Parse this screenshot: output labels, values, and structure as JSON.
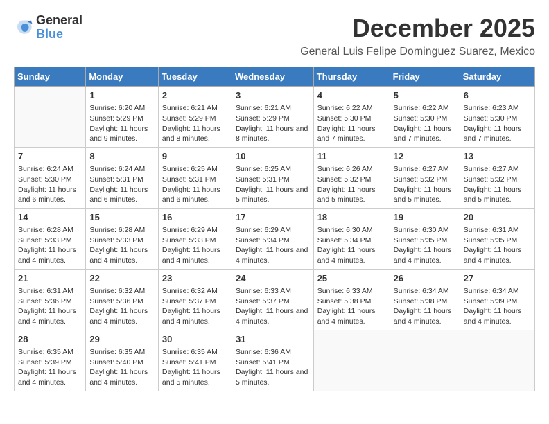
{
  "header": {
    "logo_general": "General",
    "logo_blue": "Blue",
    "month": "December 2025",
    "location": "General Luis Felipe Dominguez Suarez, Mexico"
  },
  "days_of_week": [
    "Sunday",
    "Monday",
    "Tuesday",
    "Wednesday",
    "Thursday",
    "Friday",
    "Saturday"
  ],
  "weeks": [
    [
      {
        "day": "",
        "sunrise": "",
        "sunset": "",
        "daylight": ""
      },
      {
        "day": "1",
        "sunrise": "Sunrise: 6:20 AM",
        "sunset": "Sunset: 5:29 PM",
        "daylight": "Daylight: 11 hours and 9 minutes."
      },
      {
        "day": "2",
        "sunrise": "Sunrise: 6:21 AM",
        "sunset": "Sunset: 5:29 PM",
        "daylight": "Daylight: 11 hours and 8 minutes."
      },
      {
        "day": "3",
        "sunrise": "Sunrise: 6:21 AM",
        "sunset": "Sunset: 5:29 PM",
        "daylight": "Daylight: 11 hours and 8 minutes."
      },
      {
        "day": "4",
        "sunrise": "Sunrise: 6:22 AM",
        "sunset": "Sunset: 5:30 PM",
        "daylight": "Daylight: 11 hours and 7 minutes."
      },
      {
        "day": "5",
        "sunrise": "Sunrise: 6:22 AM",
        "sunset": "Sunset: 5:30 PM",
        "daylight": "Daylight: 11 hours and 7 minutes."
      },
      {
        "day": "6",
        "sunrise": "Sunrise: 6:23 AM",
        "sunset": "Sunset: 5:30 PM",
        "daylight": "Daylight: 11 hours and 7 minutes."
      }
    ],
    [
      {
        "day": "7",
        "sunrise": "Sunrise: 6:24 AM",
        "sunset": "Sunset: 5:30 PM",
        "daylight": "Daylight: 11 hours and 6 minutes."
      },
      {
        "day": "8",
        "sunrise": "Sunrise: 6:24 AM",
        "sunset": "Sunset: 5:31 PM",
        "daylight": "Daylight: 11 hours and 6 minutes."
      },
      {
        "day": "9",
        "sunrise": "Sunrise: 6:25 AM",
        "sunset": "Sunset: 5:31 PM",
        "daylight": "Daylight: 11 hours and 6 minutes."
      },
      {
        "day": "10",
        "sunrise": "Sunrise: 6:25 AM",
        "sunset": "Sunset: 5:31 PM",
        "daylight": "Daylight: 11 hours and 5 minutes."
      },
      {
        "day": "11",
        "sunrise": "Sunrise: 6:26 AM",
        "sunset": "Sunset: 5:32 PM",
        "daylight": "Daylight: 11 hours and 5 minutes."
      },
      {
        "day": "12",
        "sunrise": "Sunrise: 6:27 AM",
        "sunset": "Sunset: 5:32 PM",
        "daylight": "Daylight: 11 hours and 5 minutes."
      },
      {
        "day": "13",
        "sunrise": "Sunrise: 6:27 AM",
        "sunset": "Sunset: 5:32 PM",
        "daylight": "Daylight: 11 hours and 5 minutes."
      }
    ],
    [
      {
        "day": "14",
        "sunrise": "Sunrise: 6:28 AM",
        "sunset": "Sunset: 5:33 PM",
        "daylight": "Daylight: 11 hours and 4 minutes."
      },
      {
        "day": "15",
        "sunrise": "Sunrise: 6:28 AM",
        "sunset": "Sunset: 5:33 PM",
        "daylight": "Daylight: 11 hours and 4 minutes."
      },
      {
        "day": "16",
        "sunrise": "Sunrise: 6:29 AM",
        "sunset": "Sunset: 5:33 PM",
        "daylight": "Daylight: 11 hours and 4 minutes."
      },
      {
        "day": "17",
        "sunrise": "Sunrise: 6:29 AM",
        "sunset": "Sunset: 5:34 PM",
        "daylight": "Daylight: 11 hours and 4 minutes."
      },
      {
        "day": "18",
        "sunrise": "Sunrise: 6:30 AM",
        "sunset": "Sunset: 5:34 PM",
        "daylight": "Daylight: 11 hours and 4 minutes."
      },
      {
        "day": "19",
        "sunrise": "Sunrise: 6:30 AM",
        "sunset": "Sunset: 5:35 PM",
        "daylight": "Daylight: 11 hours and 4 minutes."
      },
      {
        "day": "20",
        "sunrise": "Sunrise: 6:31 AM",
        "sunset": "Sunset: 5:35 PM",
        "daylight": "Daylight: 11 hours and 4 minutes."
      }
    ],
    [
      {
        "day": "21",
        "sunrise": "Sunrise: 6:31 AM",
        "sunset": "Sunset: 5:36 PM",
        "daylight": "Daylight: 11 hours and 4 minutes."
      },
      {
        "day": "22",
        "sunrise": "Sunrise: 6:32 AM",
        "sunset": "Sunset: 5:36 PM",
        "daylight": "Daylight: 11 hours and 4 minutes."
      },
      {
        "day": "23",
        "sunrise": "Sunrise: 6:32 AM",
        "sunset": "Sunset: 5:37 PM",
        "daylight": "Daylight: 11 hours and 4 minutes."
      },
      {
        "day": "24",
        "sunrise": "Sunrise: 6:33 AM",
        "sunset": "Sunset: 5:37 PM",
        "daylight": "Daylight: 11 hours and 4 minutes."
      },
      {
        "day": "25",
        "sunrise": "Sunrise: 6:33 AM",
        "sunset": "Sunset: 5:38 PM",
        "daylight": "Daylight: 11 hours and 4 minutes."
      },
      {
        "day": "26",
        "sunrise": "Sunrise: 6:34 AM",
        "sunset": "Sunset: 5:38 PM",
        "daylight": "Daylight: 11 hours and 4 minutes."
      },
      {
        "day": "27",
        "sunrise": "Sunrise: 6:34 AM",
        "sunset": "Sunset: 5:39 PM",
        "daylight": "Daylight: 11 hours and 4 minutes."
      }
    ],
    [
      {
        "day": "28",
        "sunrise": "Sunrise: 6:35 AM",
        "sunset": "Sunset: 5:39 PM",
        "daylight": "Daylight: 11 hours and 4 minutes."
      },
      {
        "day": "29",
        "sunrise": "Sunrise: 6:35 AM",
        "sunset": "Sunset: 5:40 PM",
        "daylight": "Daylight: 11 hours and 4 minutes."
      },
      {
        "day": "30",
        "sunrise": "Sunrise: 6:35 AM",
        "sunset": "Sunset: 5:41 PM",
        "daylight": "Daylight: 11 hours and 5 minutes."
      },
      {
        "day": "31",
        "sunrise": "Sunrise: 6:36 AM",
        "sunset": "Sunset: 5:41 PM",
        "daylight": "Daylight: 11 hours and 5 minutes."
      },
      {
        "day": "",
        "sunrise": "",
        "sunset": "",
        "daylight": ""
      },
      {
        "day": "",
        "sunrise": "",
        "sunset": "",
        "daylight": ""
      },
      {
        "day": "",
        "sunrise": "",
        "sunset": "",
        "daylight": ""
      }
    ]
  ]
}
